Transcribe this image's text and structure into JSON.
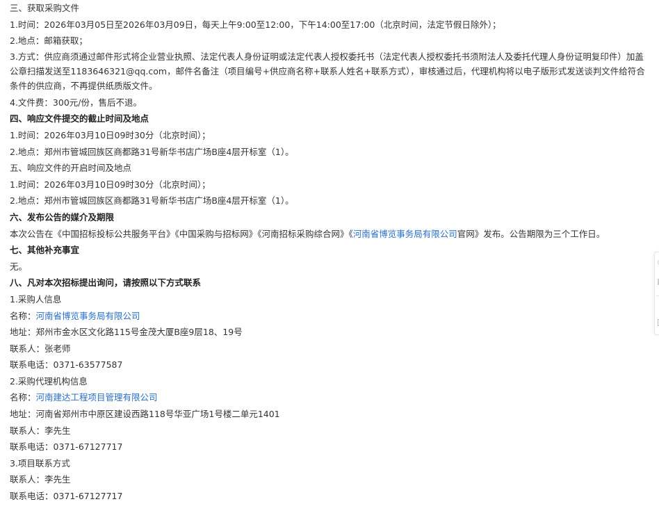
{
  "sec3": {
    "title": "三、获取采购文件",
    "time": "1.时间：2026年03月05日至2026年03月09日，每天上午9:00至12:00，下午14:00至17:00（北京时间，法定节假日除外）；",
    "place": "2.地点：邮箱获取；",
    "method": "3.方式：供应商须通过邮件形式将企业营业执照、法定代表人身份证明或法定代表人授权委托书（法定代表人授权委托书须附法人及委托代理人身份证明复印件）加盖公章扫描发送至1183646321@qq.com，邮件名备注（项目编号+供应商名称+联系人姓名+联系方式），审核通过后，代理机构将以电子版形式发送谈判文件给符合条件的供应商，不再提供纸质版文件。",
    "fee": "4.文件费：300元/份，售后不退。"
  },
  "sec4": {
    "title": "四、响应文件提交的截止时间及地点",
    "time": "1.时间：2026年03月10日09时30分（北京时间）；",
    "place": "2.地点：郑州市管城回族区商都路31号新华书店广场B座4层开标室（1）。"
  },
  "sec5": {
    "title": "五、响应文件的开启时间及地点",
    "time": "1.时间：2026年03月10日09时30分（北京时间）；",
    "place": "2.地点：郑州市管城回族区商都路31号新华书店广场B座4层开标室（1）。"
  },
  "sec6": {
    "title": "六、发布公告的媒介及期限",
    "text_before": "本次公告在《中国招标投标公共服务平台》《中国采购与招标网》《河南招标采购综合网》《",
    "link": "河南省博览事务局有限公司",
    "text_after": "官网》发布。公告期限为三个工作日。"
  },
  "sec7": {
    "title": "七、其他补充事宜",
    "text": "无。"
  },
  "sec8": {
    "title": "八、凡对本次招标提出询问，请按照以下方式联系",
    "purchaser": {
      "heading": "1.采购人信息",
      "name_label": "名称：",
      "name": "河南省博览事务局有限公司",
      "address": "地址：郑州市金水区文化路115号金茂大厦B座9层18、19号",
      "contact": "联系人：张老师",
      "phone": "联系电话：0371-63577587"
    },
    "agency": {
      "heading": "2.采购代理机构信息",
      "name_label": "名称：",
      "name": "河南建达工程项目管理有限公司",
      "address": "地址：河南省郑州市中原区建设西路118号华亚广场1号楼二单元1401",
      "contact": "联系人：李先生",
      "phone": "联系电话：0371-67127717"
    },
    "project": {
      "heading": "3.项目联系方式",
      "contact": "联系人：李先生",
      "phone": "联系电话：0371-67127717"
    }
  },
  "colors": {
    "link": "#2a6fc9",
    "text": "#333333"
  }
}
